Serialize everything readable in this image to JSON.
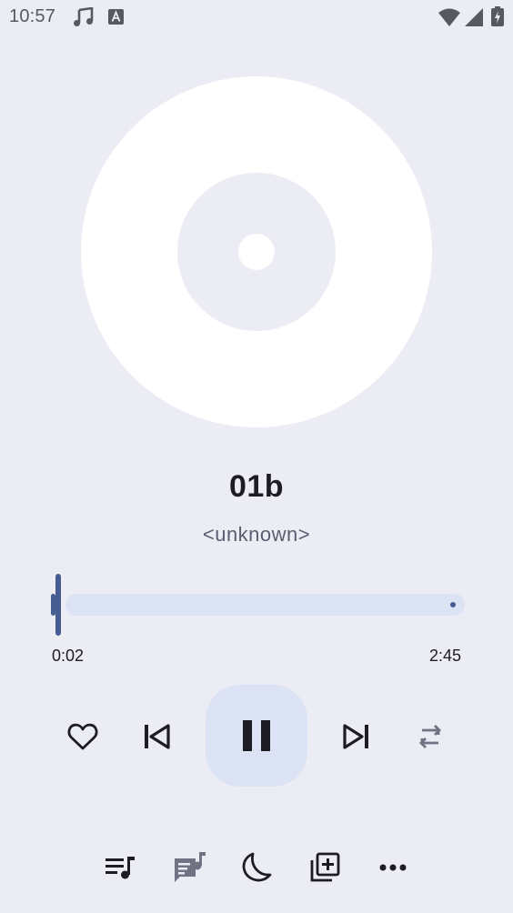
{
  "status_bar": {
    "time": "10:57",
    "icons": [
      "music-note-icon",
      "font-a-icon",
      "wifi-icon",
      "cell-signal-icon",
      "battery-charging-icon"
    ]
  },
  "track": {
    "title": "01b",
    "artist": "<unknown>"
  },
  "progress": {
    "elapsed": "0:02",
    "total": "2:45",
    "fraction": 0.012
  },
  "controls": {
    "favorite": "heart-icon",
    "previous": "skip-previous-icon",
    "play_pause": "pause-icon",
    "next": "skip-next-icon",
    "repeat": "repeat-icon"
  },
  "bottom_bar": {
    "items": [
      "queue-music-icon",
      "lyrics-icon",
      "sleep-timer-moon-icon",
      "add-to-playlist-icon",
      "more-options-icon"
    ]
  },
  "colors": {
    "background": "#ebecf4",
    "accent": "#475d92",
    "accent_container": "#dce3f5",
    "on_surface": "#1c1c22",
    "on_surface_variant": "#5b5e70"
  }
}
